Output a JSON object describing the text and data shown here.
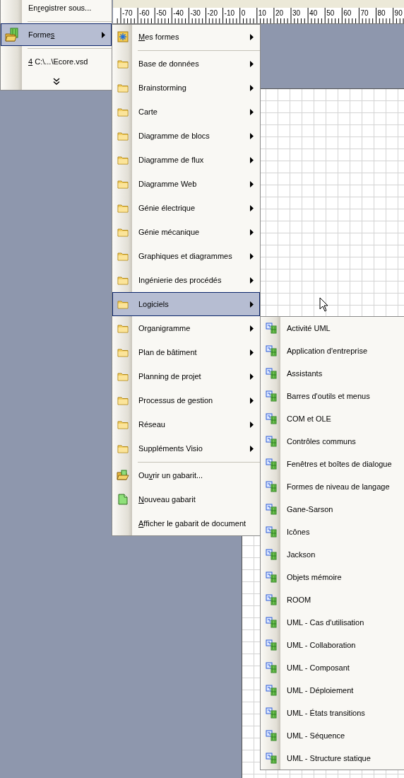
{
  "ruler": {
    "labels": [
      "-70",
      "-60",
      "-50",
      "-40",
      "-30",
      "-20",
      "-10",
      "0",
      "10",
      "20",
      "30",
      "40",
      "50",
      "60",
      "70",
      "80",
      "90"
    ]
  },
  "file_menu": {
    "items": [
      {
        "kind": "action",
        "label": "En",
        "access_key": "r",
        "label_rest": "egistrer sous...",
        "selected": false,
        "has_submenu": false
      },
      {
        "kind": "separator"
      },
      {
        "kind": "shapes",
        "label": "Forme",
        "access_key": "s",
        "selected": true,
        "has_submenu": true
      },
      {
        "kind": "separator"
      },
      {
        "kind": "action",
        "access_key": "4",
        "label_rest": " C:\\...\\Ecore.vsd",
        "selected": false,
        "has_submenu": false
      },
      {
        "kind": "expand"
      }
    ]
  },
  "shapes_menu": {
    "items": [
      {
        "kind": "my-shapes",
        "access_key": "M",
        "label_rest": "es formes",
        "selected": false,
        "has_submenu": true
      },
      {
        "kind": "separator"
      },
      {
        "kind": "folder",
        "label": "Base de données",
        "selected": false,
        "has_submenu": true
      },
      {
        "kind": "folder",
        "label": "Brainstorming",
        "selected": false,
        "has_submenu": true
      },
      {
        "kind": "folder",
        "label": "Carte",
        "selected": false,
        "has_submenu": true
      },
      {
        "kind": "folder",
        "label": "Diagramme de blocs",
        "selected": false,
        "has_submenu": true
      },
      {
        "kind": "folder",
        "label": "Diagramme de flux",
        "selected": false,
        "has_submenu": true
      },
      {
        "kind": "folder",
        "label": "Diagramme Web",
        "selected": false,
        "has_submenu": true
      },
      {
        "kind": "folder",
        "label": "Génie électrique",
        "selected": false,
        "has_submenu": true
      },
      {
        "kind": "folder",
        "label": "Génie mécanique",
        "selected": false,
        "has_submenu": true
      },
      {
        "kind": "folder",
        "label": "Graphiques et diagrammes",
        "selected": false,
        "has_submenu": true
      },
      {
        "kind": "folder",
        "label": "Ingénierie des procédés",
        "selected": false,
        "has_submenu": true
      },
      {
        "kind": "folder",
        "label": "Logiciels",
        "selected": true,
        "has_submenu": true
      },
      {
        "kind": "folder",
        "label": "Organigramme",
        "selected": false,
        "has_submenu": true
      },
      {
        "kind": "folder",
        "label": "Plan de bâtiment",
        "selected": false,
        "has_submenu": true
      },
      {
        "kind": "folder",
        "label": "Planning de projet",
        "selected": false,
        "has_submenu": true
      },
      {
        "kind": "folder",
        "label": "Processus de gestion",
        "selected": false,
        "has_submenu": true
      },
      {
        "kind": "folder",
        "label": "Réseau",
        "selected": false,
        "has_submenu": true
      },
      {
        "kind": "folder",
        "label": "Suppléments Visio",
        "selected": false,
        "has_submenu": true
      },
      {
        "kind": "separator"
      },
      {
        "kind": "open",
        "label": "Ou",
        "access_key": "v",
        "label_rest": "rir un gabarit...",
        "selected": false,
        "has_submenu": false
      },
      {
        "kind": "new",
        "access_key": "N",
        "label_rest": "ouveau gabarit",
        "selected": false,
        "has_submenu": false
      },
      {
        "kind": "action",
        "access_key": "A",
        "label_rest": "fficher le gabarit de document",
        "selected": false,
        "has_submenu": false
      }
    ]
  },
  "software_menu": {
    "items": [
      {
        "kind": "stencil",
        "label": "Activité UML",
        "selected": false,
        "has_submenu": false
      },
      {
        "kind": "stencil",
        "label": "Application d'entreprise",
        "selected": false,
        "has_submenu": false
      },
      {
        "kind": "stencil",
        "label": "Assistants",
        "selected": false,
        "has_submenu": false
      },
      {
        "kind": "stencil",
        "label": "Barres d'outils et menus",
        "selected": false,
        "has_submenu": false
      },
      {
        "kind": "stencil",
        "label": "COM et OLE",
        "selected": false,
        "has_submenu": false
      },
      {
        "kind": "stencil",
        "label": "Contrôles communs",
        "selected": false,
        "has_submenu": false
      },
      {
        "kind": "stencil",
        "label": "Fenêtres et boîtes de dialogue",
        "selected": false,
        "has_submenu": false
      },
      {
        "kind": "stencil",
        "label": "Formes de niveau de langage",
        "selected": false,
        "has_submenu": false
      },
      {
        "kind": "stencil",
        "label": "Gane-Sarson",
        "selected": false,
        "has_submenu": false
      },
      {
        "kind": "stencil",
        "label": "Icônes",
        "selected": false,
        "has_submenu": false
      },
      {
        "kind": "stencil",
        "label": "Jackson",
        "selected": false,
        "has_submenu": false
      },
      {
        "kind": "stencil",
        "label": "Objets mémoire",
        "selected": false,
        "has_submenu": false
      },
      {
        "kind": "stencil",
        "label": "ROOM",
        "selected": false,
        "has_submenu": false
      },
      {
        "kind": "stencil",
        "label": "UML - Cas d'utilisation",
        "selected": false,
        "has_submenu": false
      },
      {
        "kind": "stencil",
        "label": "UML - Collaboration",
        "selected": false,
        "has_submenu": false
      },
      {
        "kind": "stencil",
        "label": "UML - Composant",
        "selected": false,
        "has_submenu": false
      },
      {
        "kind": "stencil",
        "label": "UML - Déploiement",
        "selected": false,
        "has_submenu": false
      },
      {
        "kind": "stencil",
        "label": "UML - États transitions",
        "selected": false,
        "has_submenu": false
      },
      {
        "kind": "stencil",
        "label": "UML - Séquence",
        "selected": false,
        "has_submenu": false
      },
      {
        "kind": "stencil",
        "label": "UML - Structure statique",
        "selected": false,
        "has_submenu": false
      }
    ]
  }
}
